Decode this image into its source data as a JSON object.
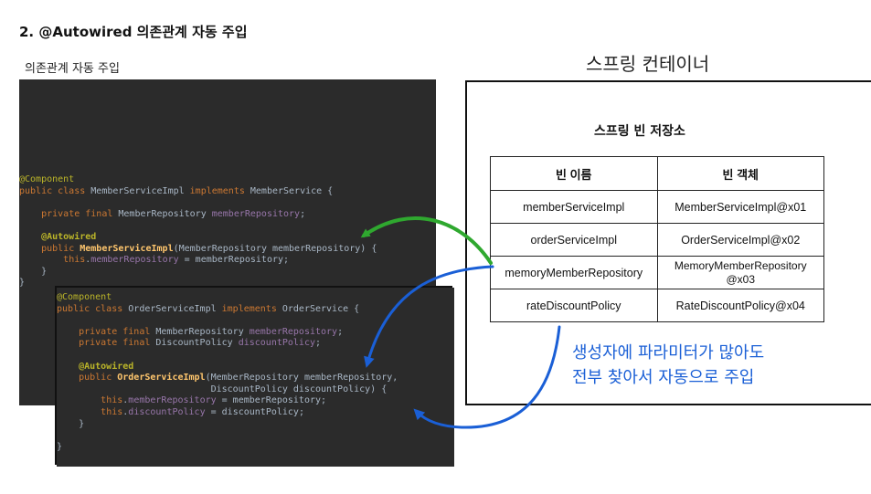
{
  "title": "2. @Autowired 의존관계 자동 주입",
  "subtitle": "의존관계 자동 주입",
  "container_label": "스프링 컨테이너",
  "repository_title": "스프링 빈 저장소",
  "table": {
    "headers": [
      "빈 이름",
      "빈 객체"
    ],
    "rows": [
      [
        "memberServiceImpl",
        "MemberServiceImpl@x01"
      ],
      [
        "orderServiceImpl",
        "OrderServiceImpl@x02"
      ],
      [
        "memoryMemberRepository",
        "MemoryMemberRepository @x03"
      ],
      [
        "rateDiscountPolicy",
        "RateDiscountPolicy@x04"
      ]
    ]
  },
  "note": [
    "생성자에 파라미터가 많아도",
    "전부 찾아서 자동으로 주입"
  ],
  "colors": {
    "green_arrow": "#2fa82f",
    "blue_arrow": "#1a5fd6",
    "code_bg": "#2b2b2b"
  },
  "code1": [
    "@Component",
    "public class MemberServiceImpl implements MemberService {",
    "",
    "    private final MemberRepository memberRepository;",
    "",
    "    @Autowired",
    "    public MemberServiceImpl(MemberRepository memberRepository) {",
    "        this.memberRepository = memberRepository;",
    "    }",
    "}"
  ],
  "code2": [
    "@Component",
    "public class OrderServiceImpl implements OrderService {",
    "",
    "    private final MemberRepository memberRepository;",
    "    private final DiscountPolicy discountPolicy;",
    "",
    "    @Autowired",
    "    public OrderServiceImpl(MemberRepository memberRepository,",
    "                            DiscountPolicy discountPolicy) {",
    "        this.memberRepository = memberRepository;",
    "        this.discountPolicy = discountPolicy;",
    "    }",
    "",
    "}"
  ]
}
